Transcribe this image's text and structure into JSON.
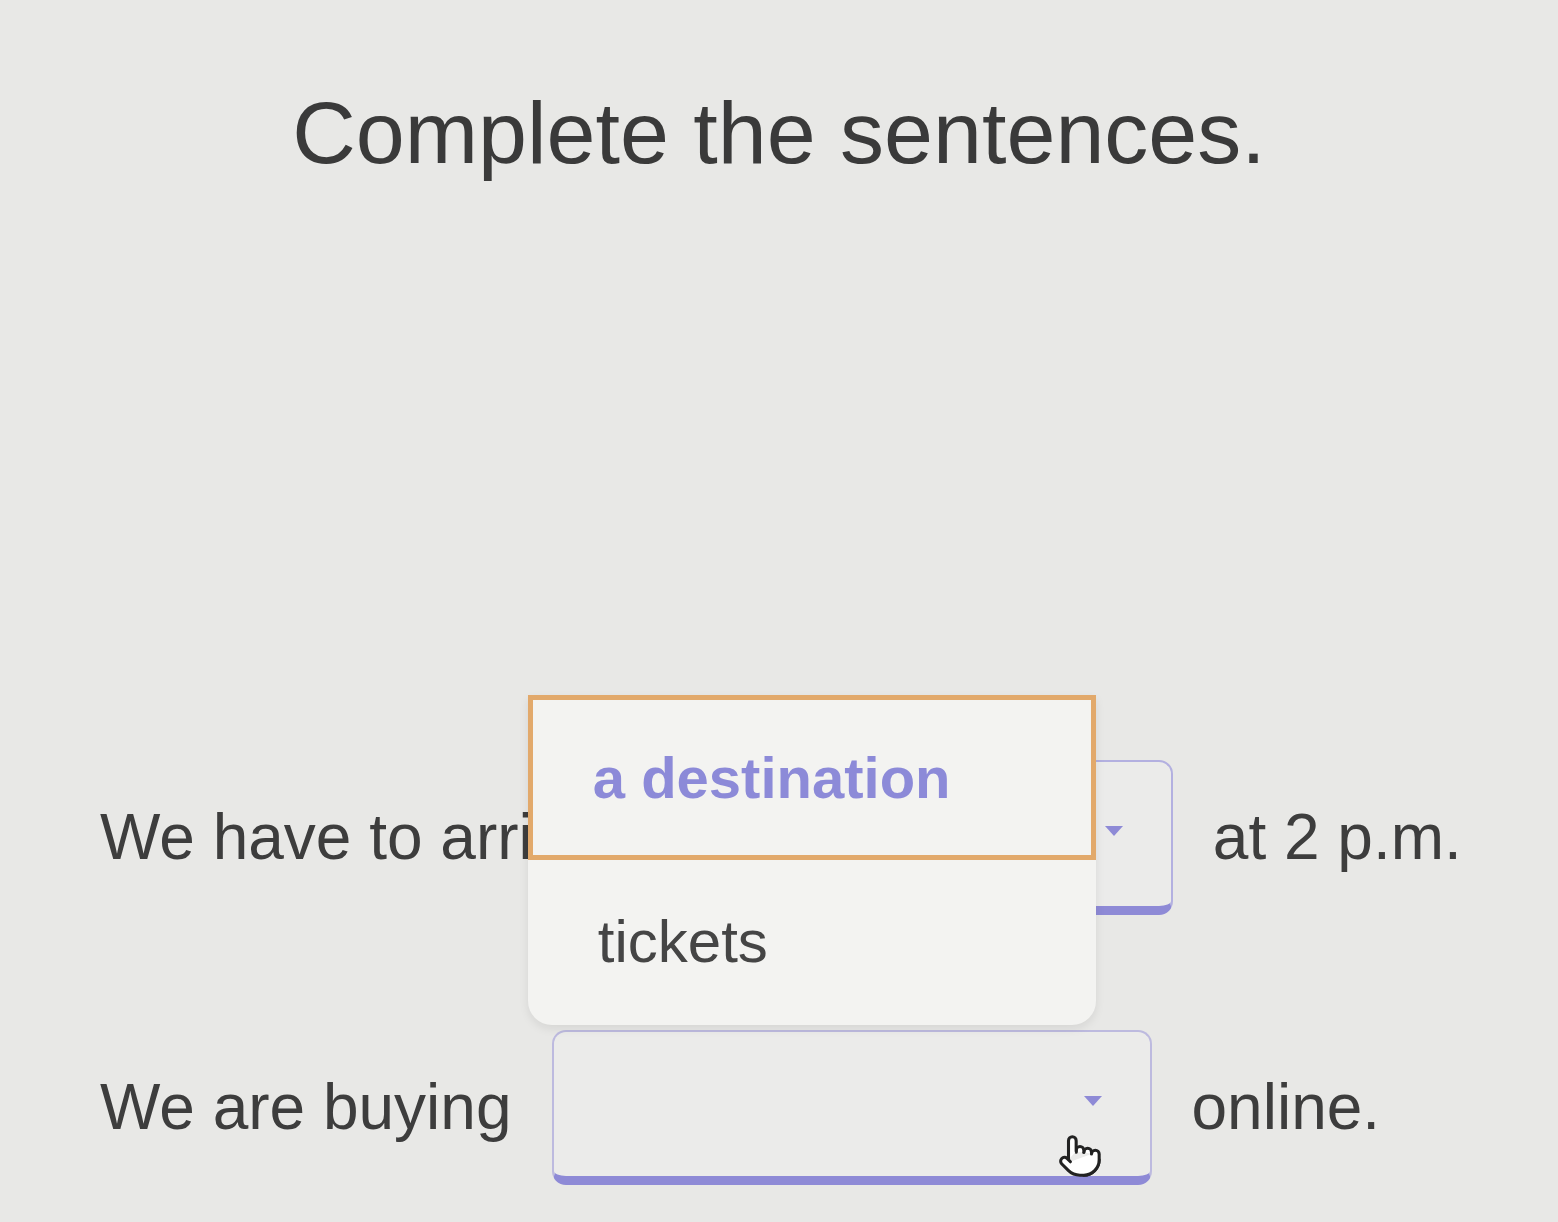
{
  "title": "Complete the sentences.",
  "sentences": [
    {
      "before": "We have to arri",
      "select": {
        "expanded": true,
        "options": [
          {
            "label": "a destination",
            "selected": true
          },
          {
            "label": "tickets",
            "selected": false
          }
        ]
      },
      "after": "at 2 p.m."
    },
    {
      "before": "We are buying",
      "select": {
        "expanded": false
      },
      "after": "online."
    }
  ]
}
